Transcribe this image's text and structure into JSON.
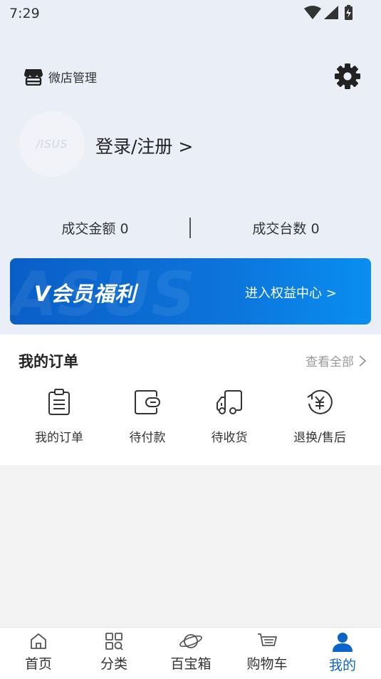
{
  "status_bar": {
    "time": "7:29"
  },
  "header": {
    "shop_label": "微店管理",
    "avatar_logo_text": "/ISUS",
    "login_label": "登录/注册 >"
  },
  "stats": {
    "amount_label": "成交金额 0",
    "count_label": "成交台数 0"
  },
  "banner": {
    "title": "V会员福利",
    "link_label": "进入权益中心 >",
    "background_logo_text": "ASUS"
  },
  "orders": {
    "title": "我的订单",
    "view_all": "查看全部",
    "items": [
      {
        "label": "我的订单",
        "icon": "clipboard-icon"
      },
      {
        "label": "待付款",
        "icon": "wallet-icon"
      },
      {
        "label": "待收货",
        "icon": "truck-icon"
      },
      {
        "label": "退换/售后",
        "icon": "yen-refund-icon"
      }
    ]
  },
  "tabs": [
    {
      "label": "首页",
      "icon": "home-icon"
    },
    {
      "label": "分类",
      "icon": "grid-search-icon"
    },
    {
      "label": "百宝箱",
      "icon": "planet-icon"
    },
    {
      "label": "购物车",
      "icon": "cart-icon"
    },
    {
      "label": "我的",
      "icon": "person-icon",
      "active": true
    }
  ],
  "colors": {
    "accent": "#0b64c8",
    "header_bg": "#eaeff7",
    "banner_start": "#0a5fc7",
    "banner_end": "#0a8ef0"
  }
}
